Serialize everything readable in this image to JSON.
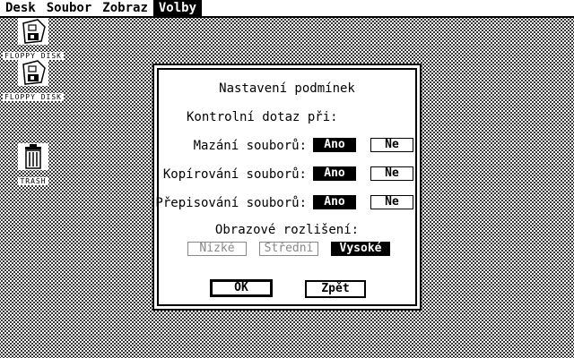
{
  "menubar": {
    "items": [
      {
        "label": "Desk",
        "active": false
      },
      {
        "label": "Soubor",
        "active": false
      },
      {
        "label": "Zobraz",
        "active": false
      },
      {
        "label": "Volby",
        "active": true
      }
    ]
  },
  "desktop": {
    "icons": [
      {
        "name": "floppy-disk-icon",
        "label": "FLOPPY DISK"
      },
      {
        "name": "floppy-disk-icon",
        "label": "FLOPPY DISK"
      },
      {
        "name": "trash-icon",
        "label": "TRASH"
      }
    ]
  },
  "dialog": {
    "title": "Nastavení podmínek",
    "subtitle": "Kontrolní dotaz při:",
    "rows": [
      {
        "label": "Mazání souborů:",
        "yes": "Ano",
        "no": "Ne",
        "selected": "yes"
      },
      {
        "label": "Kopírování souborů:",
        "yes": "Ano",
        "no": "Ne",
        "selected": "yes"
      },
      {
        "label": "Přepisování souborů:",
        "yes": "Ano",
        "no": "Ne",
        "selected": "yes"
      }
    ],
    "resolution_label": "Obrazové rozlišení:",
    "resolution_options": [
      {
        "label": "Nízké",
        "state": "disabled"
      },
      {
        "label": "Střední",
        "state": "disabled"
      },
      {
        "label": "Vysoké",
        "state": "selected"
      }
    ],
    "ok_label": "OK",
    "back_label": "Zpět"
  }
}
